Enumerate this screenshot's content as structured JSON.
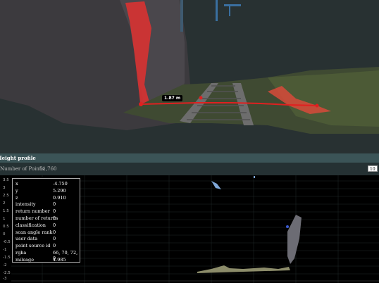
{
  "viewer": {
    "measurement_label": "1.87 m"
  },
  "profile": {
    "title": "Height profile",
    "points_label": "Number of Points:",
    "points_value": "51,760",
    "width_value": "10",
    "y_ticks": [
      "3.5",
      "3",
      "2.5",
      "2",
      "1.5",
      "1",
      "0.5",
      "0",
      "-0.5",
      "-1",
      "-1.5",
      "-2",
      "-2.5",
      "-3"
    ]
  },
  "tooltip": {
    "rows": [
      {
        "key": "x",
        "value": "-4.750"
      },
      {
        "key": "y",
        "value": "5.290"
      },
      {
        "key": "z",
        "value": "0.910"
      },
      {
        "key": "intensity",
        "value": "0"
      },
      {
        "key": "return number",
        "value": "0"
      },
      {
        "key": "number of returns",
        "value": "0"
      },
      {
        "key": "classification",
        "value": "0"
      },
      {
        "key": "scan angle rank",
        "value": "0"
      },
      {
        "key": "user data",
        "value": "0"
      },
      {
        "key": "point source id",
        "value": "0"
      },
      {
        "key": "rgba",
        "value": "66, 70, 72, 0"
      },
      {
        "key": "mileage",
        "value": "4.985"
      }
    ]
  }
}
